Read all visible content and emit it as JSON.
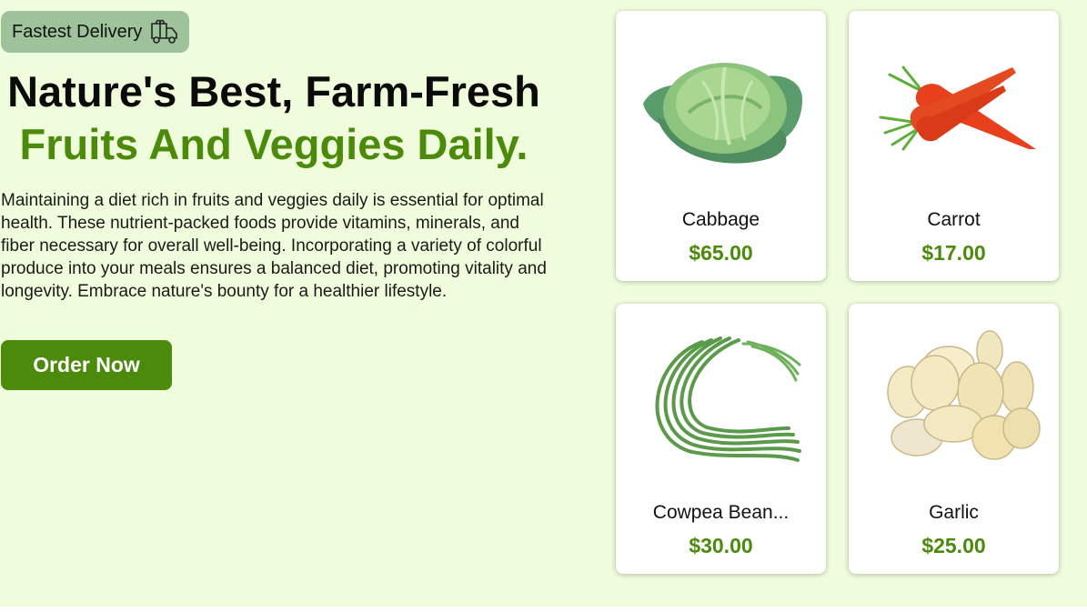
{
  "badge": {
    "label": "Fastest Delivery",
    "icon": "truck-icon"
  },
  "hero": {
    "title_line1": "Nature's Best, Farm-Fresh",
    "title_line2": "Fruits And Veggies Daily.",
    "description": "Maintaining a diet rich in fruits and veggies daily is essential for optimal health. These nutrient-packed foods provide vitamins, minerals, and fiber necessary for overall well-being. Incorporating a variety of colorful produce into your meals ensures a balanced diet, promoting vitality and longevity. Embrace nature's bounty for a healthier lifestyle.",
    "order_button": "Order Now"
  },
  "colors": {
    "background": "#f0fddc",
    "accent": "#4b8a0a",
    "badge": "#9ec39a"
  },
  "products": [
    {
      "name": "Cabbage",
      "price": "$65.00",
      "icon": "cabbage-image"
    },
    {
      "name": "Carrot",
      "price": "$17.00",
      "icon": "carrot-image"
    },
    {
      "name": "Cowpea Bean...",
      "price": "$30.00",
      "icon": "cowpea-bean-image"
    },
    {
      "name": "Garlic",
      "price": "$25.00",
      "icon": "garlic-image"
    }
  ]
}
